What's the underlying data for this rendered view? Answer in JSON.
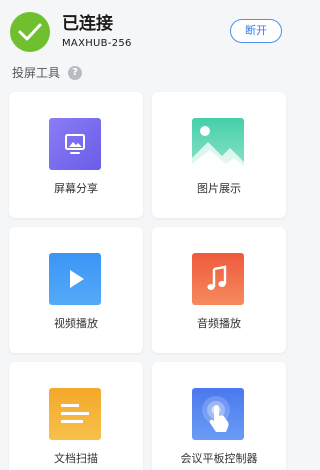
{
  "header": {
    "status_title": "已连接",
    "device_name": "MAXHUB-256",
    "disconnect_label": "断开"
  },
  "section": {
    "title": "投屏工具",
    "help_icon_glyph": "?"
  },
  "tools": [
    {
      "label": "屏幕分享",
      "icon": "screen-share-icon"
    },
    {
      "label": "图片展示",
      "icon": "image-gallery-icon"
    },
    {
      "label": "视频播放",
      "icon": "video-play-icon"
    },
    {
      "label": "音频播放",
      "icon": "music-note-icon"
    },
    {
      "label": "文档扫描",
      "icon": "document-scan-icon"
    },
    {
      "label": "会议平板控制器",
      "icon": "touch-controller-icon"
    }
  ],
  "colors": {
    "status_green": "#6fbf2f",
    "accent_blue": "#3a7fe8",
    "screen_share_purple": "#7a6cf0",
    "image_teal": "#3cc8a6",
    "video_blue": "#3f9ef5",
    "audio_orange": "#f0643f",
    "document_yellow": "#f5b335",
    "controller_blue": "#4f7ef0"
  }
}
